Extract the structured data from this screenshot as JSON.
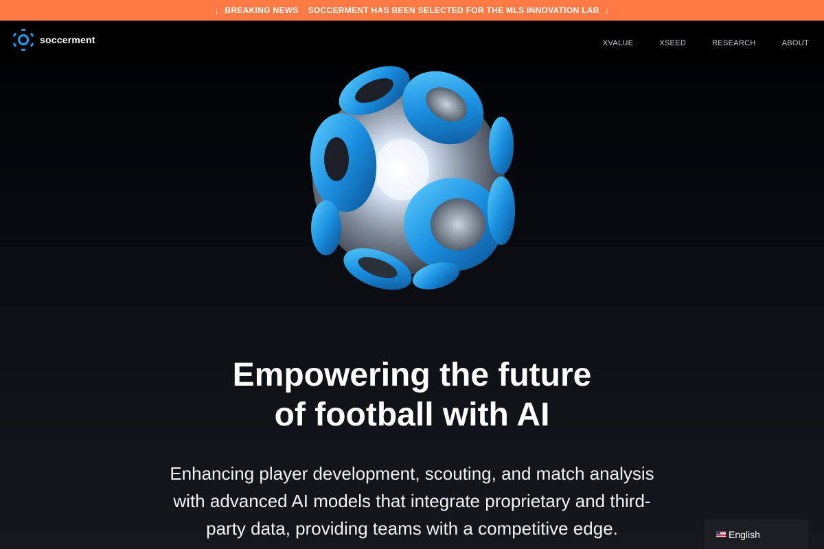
{
  "banner": {
    "label": "BREAKING NEWS",
    "text": "SOCCERMENT HAS BEEN SELECTED FOR THE MLS INNOVATION LAB",
    "color": "#ff7a45",
    "icon": "arrow-down-icon"
  },
  "brand": {
    "name": "soccerment",
    "logo_icon": "soccerment-logo-icon",
    "accent": "#1e9be6"
  },
  "nav": {
    "items": [
      "XVALUE",
      "XSEED",
      "RESEARCH",
      "ABOUT"
    ]
  },
  "hero": {
    "image_icon": "ai-football-sphere-icon",
    "headline_line1": "Empowering the future",
    "headline_line2": "of football with AI",
    "subhead_line1": "Enhancing player development, scouting, and match analysis",
    "subhead_line2": "with advanced AI models that integrate proprietary and third-",
    "subhead_line3": "party data, providing teams with a competitive edge."
  },
  "language": {
    "selected": "English",
    "flag_icon": "us-flag-icon"
  }
}
